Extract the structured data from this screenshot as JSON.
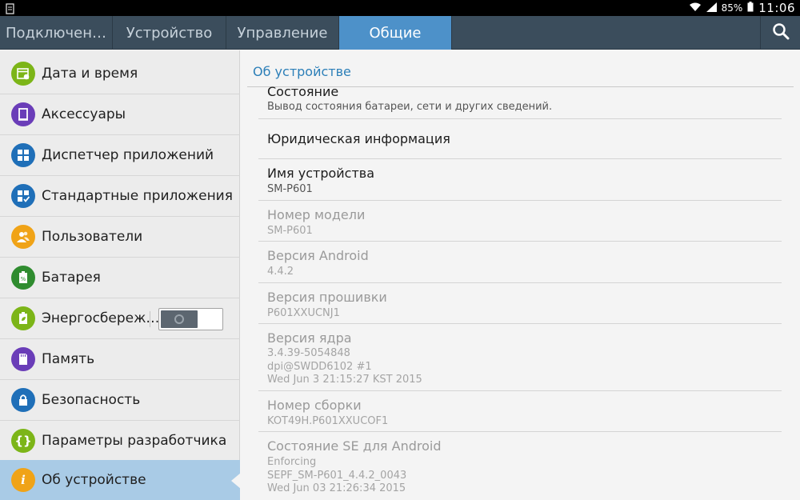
{
  "status_bar": {
    "battery": "85%",
    "time": "11:06",
    "icons": [
      "screenshot-icon",
      "wifi-icon",
      "signal-icon",
      "battery-icon"
    ]
  },
  "tabs": [
    {
      "label": "Подключен…"
    },
    {
      "label": "Устройство"
    },
    {
      "label": "Управление"
    },
    {
      "label": "Общие"
    }
  ],
  "left_menu": {
    "items": [
      {
        "label": "Дата и время",
        "icon": "calendar-icon",
        "color": "#7cb518"
      },
      {
        "label": "Аксессуары",
        "icon": "tablet-icon",
        "color": "#6a3db8"
      },
      {
        "label": "Диспетчер приложений",
        "icon": "grid-icon",
        "color": "#1f6fb8"
      },
      {
        "label": "Стандартные приложения",
        "icon": "grid-check-icon",
        "color": "#1f6fb8"
      },
      {
        "label": "Пользователи",
        "icon": "users-icon",
        "color": "#f0a317"
      },
      {
        "label": "Батарея",
        "icon": "battery-icon",
        "color": "#2f8c2f"
      },
      {
        "label": "Энергосбереж…",
        "icon": "power-saving-icon",
        "color": "#7cb518"
      },
      {
        "label": "Память",
        "icon": "sd-card-icon",
        "color": "#6a3db8"
      },
      {
        "label": "Безопасность",
        "icon": "lock-icon",
        "color": "#1f6fb8"
      },
      {
        "label": "Параметры разработчика",
        "icon": "braces-icon",
        "color": "#7cb518"
      },
      {
        "label": "Об устройстве",
        "icon": "info-icon",
        "color": "#f0a317"
      }
    ]
  },
  "right_pane": {
    "section_title": "Об устройстве",
    "items": [
      {
        "title": "Состояние",
        "lines": [
          "Вывод состояния батареи, сети и других сведений."
        ]
      },
      {
        "title": "Юридическая информация",
        "lines": []
      },
      {
        "title": "Имя устройства",
        "lines": [
          "SM-P601"
        ]
      },
      {
        "title": "Номер модели",
        "lines": [
          "SM-P601"
        ]
      },
      {
        "title": "Версия Android",
        "lines": [
          "4.4.2"
        ]
      },
      {
        "title": "Версия прошивки",
        "lines": [
          "P601XXUCNJ1"
        ]
      },
      {
        "title": "Версия ядра",
        "lines": [
          "3.4.39-5054848",
          "dpi@SWDD6102 #1",
          "Wed Jun 3 21:15:27 KST 2015"
        ]
      },
      {
        "title": "Номер сборки",
        "lines": [
          "KOT49H.P601XXUCOF1"
        ]
      },
      {
        "title": "Состояние SE для Android",
        "lines": [
          "Enforcing",
          "SEPF_SM-P601_4.4.2_0043",
          "Wed Jun 03 21:26:34 2015"
        ]
      }
    ]
  }
}
